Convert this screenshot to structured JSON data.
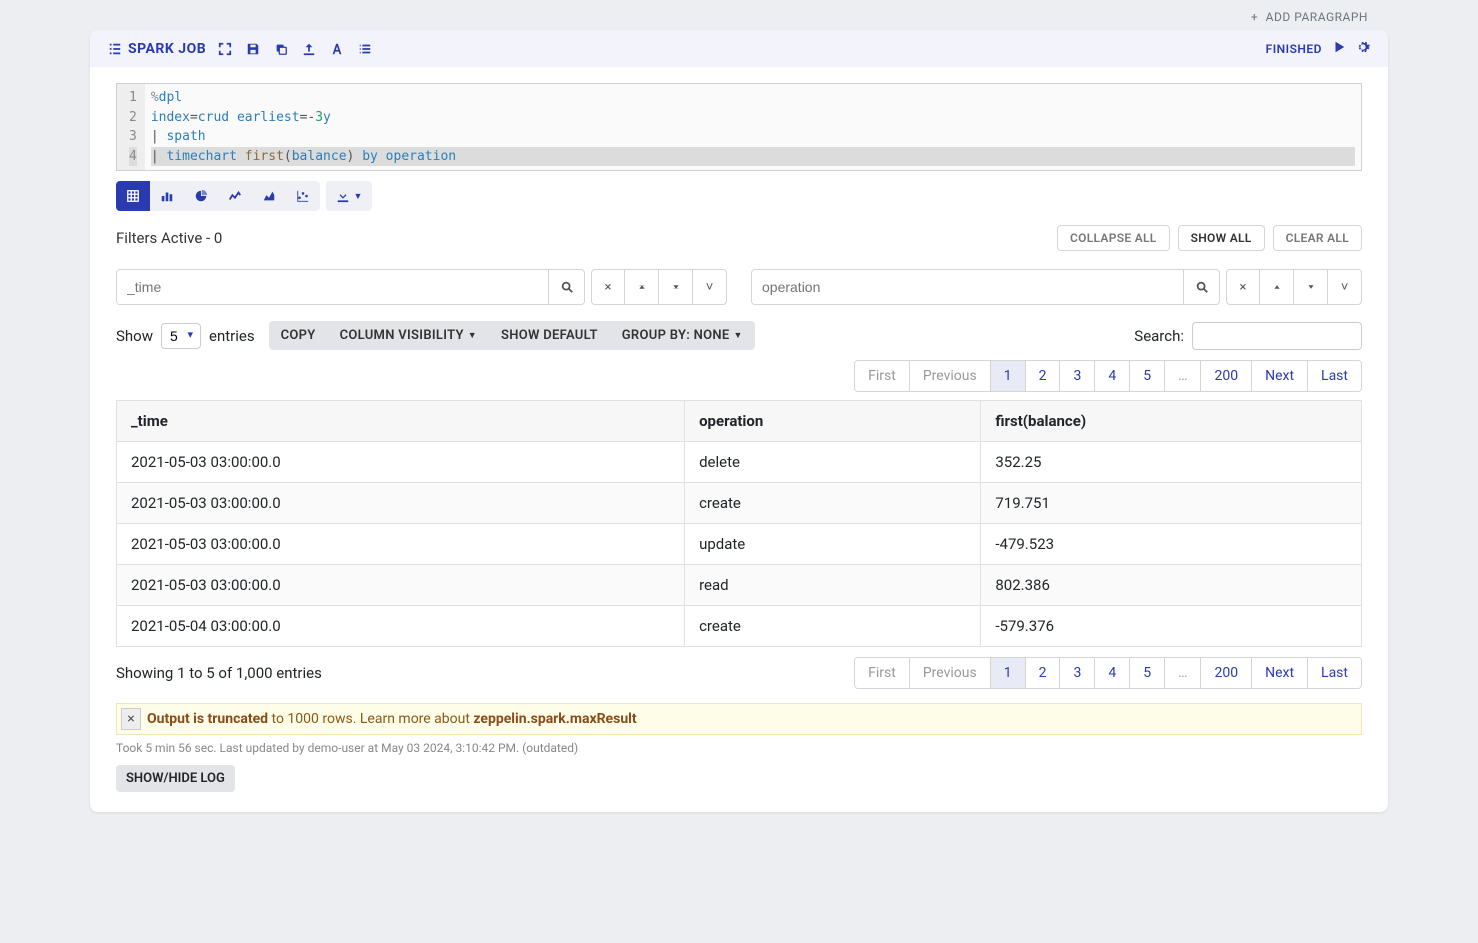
{
  "add_paragraph": "ADD PARAGRAPH",
  "header": {
    "title": "SPARK JOB",
    "status": "FINISHED"
  },
  "code": {
    "lines": [
      "1",
      "2",
      "3",
      "4"
    ],
    "l1_dpl": "dpl",
    "l2_index": "index",
    "l2_crud": "crud",
    "l2_earliest": "earliest",
    "l2_num": "3",
    "l2_y": "y",
    "l3_spath": "spath",
    "l4_timechart": "timechart",
    "l4_first": "first",
    "l4_balance": "balance",
    "l4_by": "by",
    "l4_operation": "operation"
  },
  "filters": {
    "label": "Filters Active - 0",
    "collapse_all": "COLLAPSE ALL",
    "show_all": "SHOW ALL",
    "clear_all": "CLEAR ALL",
    "col1_placeholder": "_time",
    "col2_placeholder": "operation"
  },
  "controls": {
    "show": "Show",
    "entries": "entries",
    "page_size": "5",
    "copy": "COPY",
    "colvis": "COLUMN VISIBILITY",
    "show_default": "SHOW DEFAULT",
    "group_by": "GROUP BY: NONE",
    "search_label": "Search:"
  },
  "pagination": {
    "first": "First",
    "previous": "Previous",
    "p1": "1",
    "p2": "2",
    "p3": "3",
    "p4": "4",
    "p5": "5",
    "ellipsis": "…",
    "p200": "200",
    "next": "Next",
    "last": "Last"
  },
  "table": {
    "headers": [
      "_time",
      "operation",
      "first(balance)"
    ],
    "rows": [
      [
        "2021-05-03 03:00:00.0",
        "delete",
        "352.25"
      ],
      [
        "2021-05-03 03:00:00.0",
        "create",
        "719.751"
      ],
      [
        "2021-05-03 03:00:00.0",
        "update",
        "-479.523"
      ],
      [
        "2021-05-03 03:00:00.0",
        "read",
        "802.386"
      ],
      [
        "2021-05-04 03:00:00.0",
        "create",
        "-579.376"
      ]
    ]
  },
  "showing": "Showing 1 to 5 of 1,000 entries",
  "alert": {
    "close": "×",
    "bold1": "Output is truncated",
    "mid": " to 1000 rows. Learn more about ",
    "bold2": "zeppelin.spark.maxResult"
  },
  "meta": "Took 5 min 56 sec. Last updated by demo-user at May 03 2024, 3:10:42 PM. (outdated)",
  "log_btn": "SHOW/HIDE LOG"
}
